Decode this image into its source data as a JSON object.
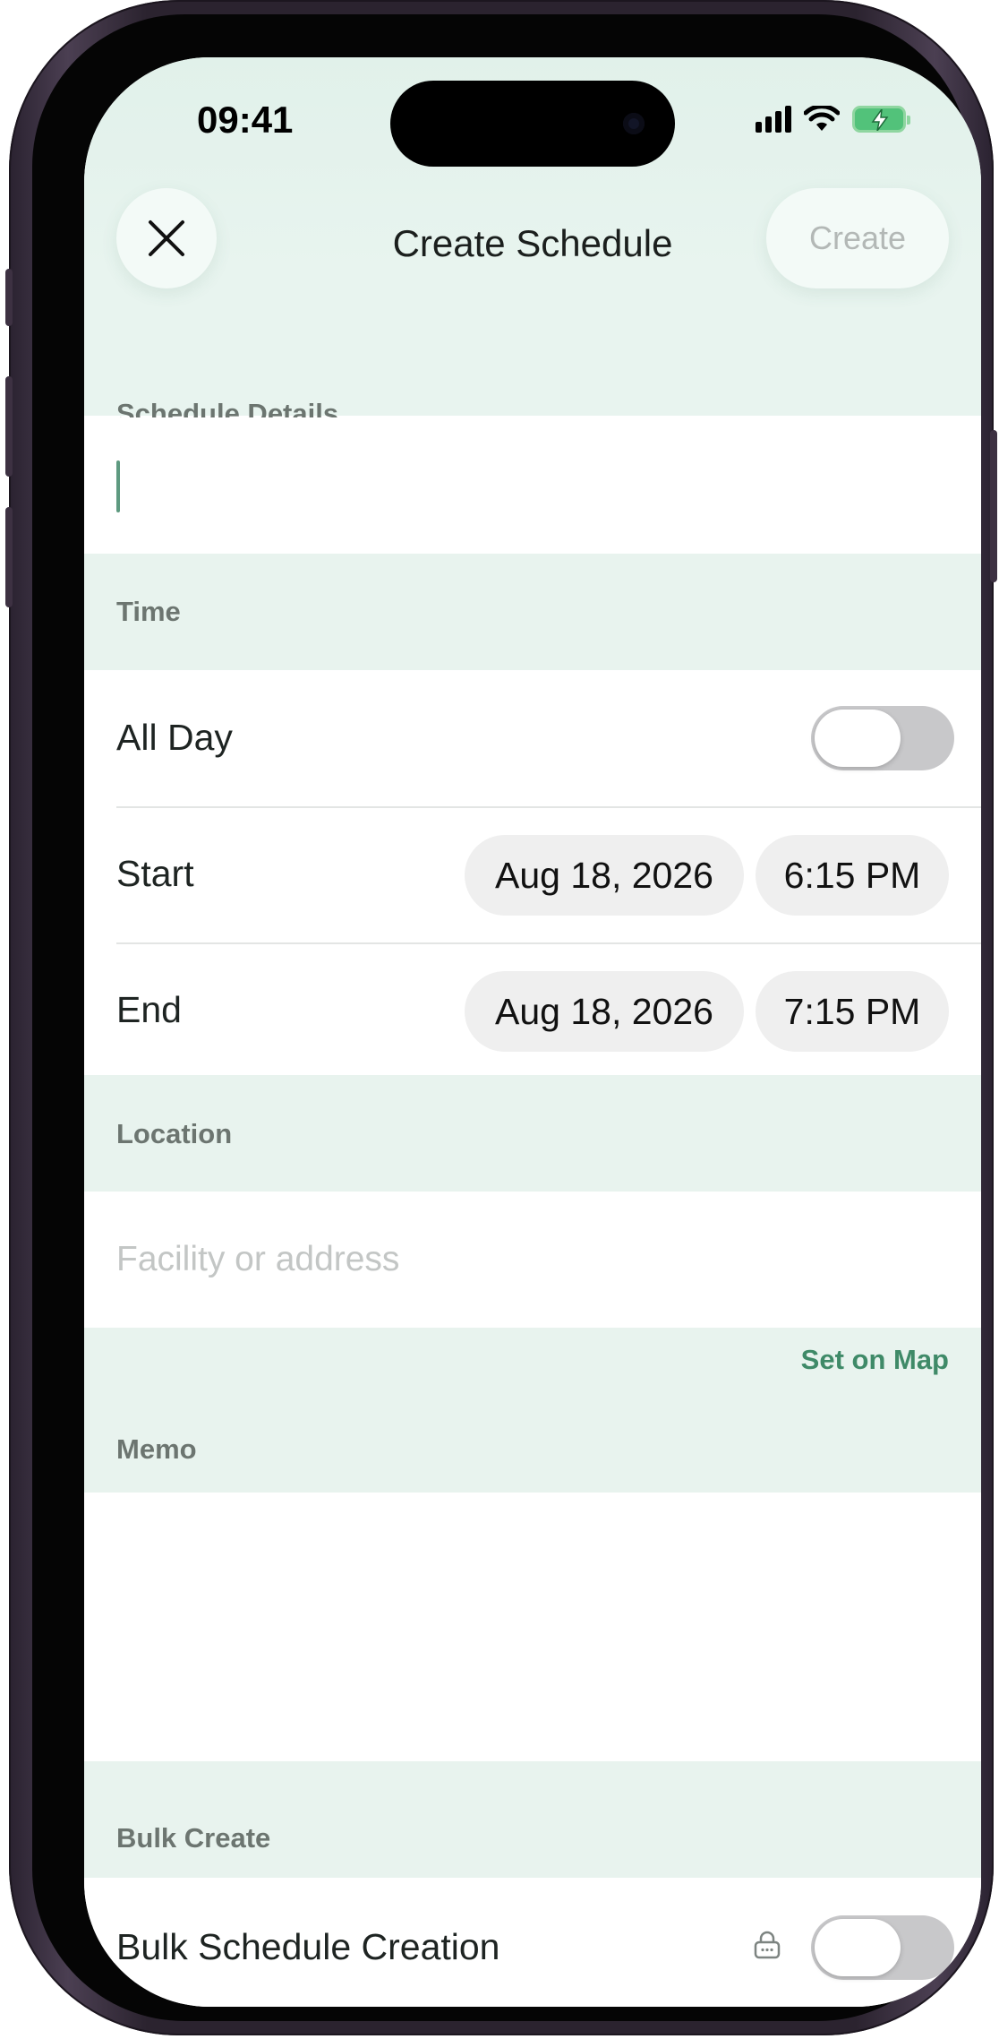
{
  "status_bar": {
    "time": "09:41"
  },
  "navbar": {
    "title": "Create Schedule",
    "create_label": "Create"
  },
  "schedule_details": {
    "header": "Schedule Details",
    "title_input_value": ""
  },
  "time_section": {
    "header": "Time",
    "all_day_label": "All Day",
    "all_day_on": false,
    "start_label": "Start",
    "start_date": "Aug 18, 2026",
    "start_time": "6:15 PM",
    "end_label": "End",
    "end_date": "Aug 18, 2026",
    "end_time": "7:15 PM"
  },
  "location_section": {
    "header": "Location",
    "placeholder": "Facility or address",
    "set_on_map_label": "Set on Map"
  },
  "memo_section": {
    "header": "Memo",
    "value": ""
  },
  "bulk_section": {
    "header": "Bulk Create",
    "bulk_label": "Bulk Schedule Creation",
    "bulk_on": false,
    "locked": true
  },
  "colors": {
    "accent": "#3f8a68",
    "section_bg": "#e8f3ee",
    "toggle_off": "#c8c8ca"
  },
  "icons": {
    "close": "close-icon",
    "lock": "lock-icon",
    "signal": "cellular-signal-icon",
    "wifi": "wifi-icon",
    "battery": "battery-charging-icon"
  }
}
